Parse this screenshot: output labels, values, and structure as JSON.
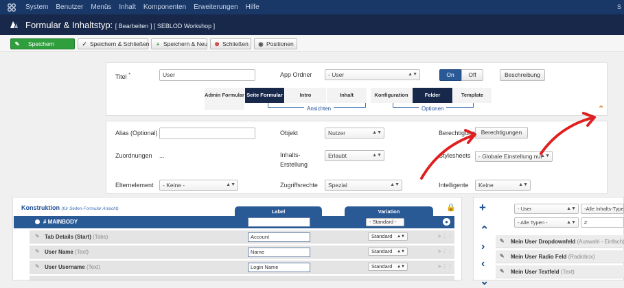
{
  "topnav": {
    "items": [
      "System",
      "Benutzer",
      "Menüs",
      "Inhalt",
      "Komponenten",
      "Erweiterungen",
      "Hilfe"
    ],
    "right_text": "S"
  },
  "titlebar": {
    "title": "Formular & Inhaltstyp:",
    "subtitle": "[ Bearbeiten ] [ SEBLOD Workshop ]"
  },
  "toolbar": {
    "save": "Speichern",
    "save_close": "Speichern & Schließen",
    "save_new": "Speichern & Neu",
    "close": "Schließen",
    "positions": "Positionen"
  },
  "form": {
    "title_label": "Titel",
    "required_marker": "*",
    "title_value": "User",
    "app_folder_label": "App Ordner",
    "app_folder_value": "- User",
    "toggle_on": "On",
    "toggle_off": "Off",
    "description_btn": "Beschreibung",
    "tabs_left": [
      "Admin Formular",
      "Seite Formular",
      "Intro",
      "Inhalt"
    ],
    "tabs_left_active": "Seite Formular",
    "ansichten_label": "Ansichten",
    "tabs_right": [
      "Konfiguration",
      "Felder",
      "Template"
    ],
    "tabs_right_active": "Felder",
    "optionen_label": "Optionen",
    "collapse_icon": "chevron-up-icon"
  },
  "props": {
    "alias_label": "Alias (Optional)",
    "alias_value": "",
    "objekt_label": "Objekt",
    "objekt_value": "Nutzer",
    "berechtigungen_label": "Berechtigunge",
    "berechtigungen_btn": "Berechtigungen",
    "zuordnungen_label": "Zuordnungen",
    "zuordnungen_value": "...",
    "inhalts_label": "Inhalts-Erstellung",
    "inhalts_value": "Erlaubt",
    "stylesheets_label": "Stylesheets",
    "stylesheets_value": "- Globale Einstellung nut",
    "eltern_label": "Elternelement",
    "eltern_value": "- Keine -",
    "zugriff_label": "Zugriffsrechte",
    "zugriff_value": "Spezial",
    "intelligente_label": "Intelligente",
    "intelligente_value": "Keine"
  },
  "konstruktion": {
    "title": "Konstruktion",
    "subtitle": "(für Seiten-Formular Ansicht)",
    "col_label": "Label",
    "col_variation": "Variation",
    "mainbody": "# MAINBODY",
    "mainbody_variation": "- Standard -",
    "rows": [
      {
        "name": "Tab Details (Start)",
        "type": "(Tabs)",
        "label": "Account",
        "variation": "Standard"
      },
      {
        "name": "User Name",
        "type": "(Text)",
        "label": "Name",
        "variation": "Standard"
      },
      {
        "name": "User Username",
        "type": "(Text)",
        "label": "Login Name",
        "variation": "Standard"
      }
    ]
  },
  "sidebar": {
    "filter1": "- User",
    "filter2": "-Alle Inhalts-Typen-",
    "filter3": "- Alle Typen -",
    "filter4": "#",
    "items": [
      {
        "name": "Mein User Dropdownfeld",
        "type": "(Auswahl - Einfach)"
      },
      {
        "name": "Mein User Radio Feld",
        "type": "(Radiobox)"
      },
      {
        "name": "Mein User Textfeld",
        "type": "(Text)"
      }
    ]
  },
  "colors": {
    "nav": "#1a3867",
    "titlebar": "#17284a",
    "accent": "#2a5a96",
    "save_green": "#2f9e3c",
    "arrow_red": "#e02020"
  }
}
